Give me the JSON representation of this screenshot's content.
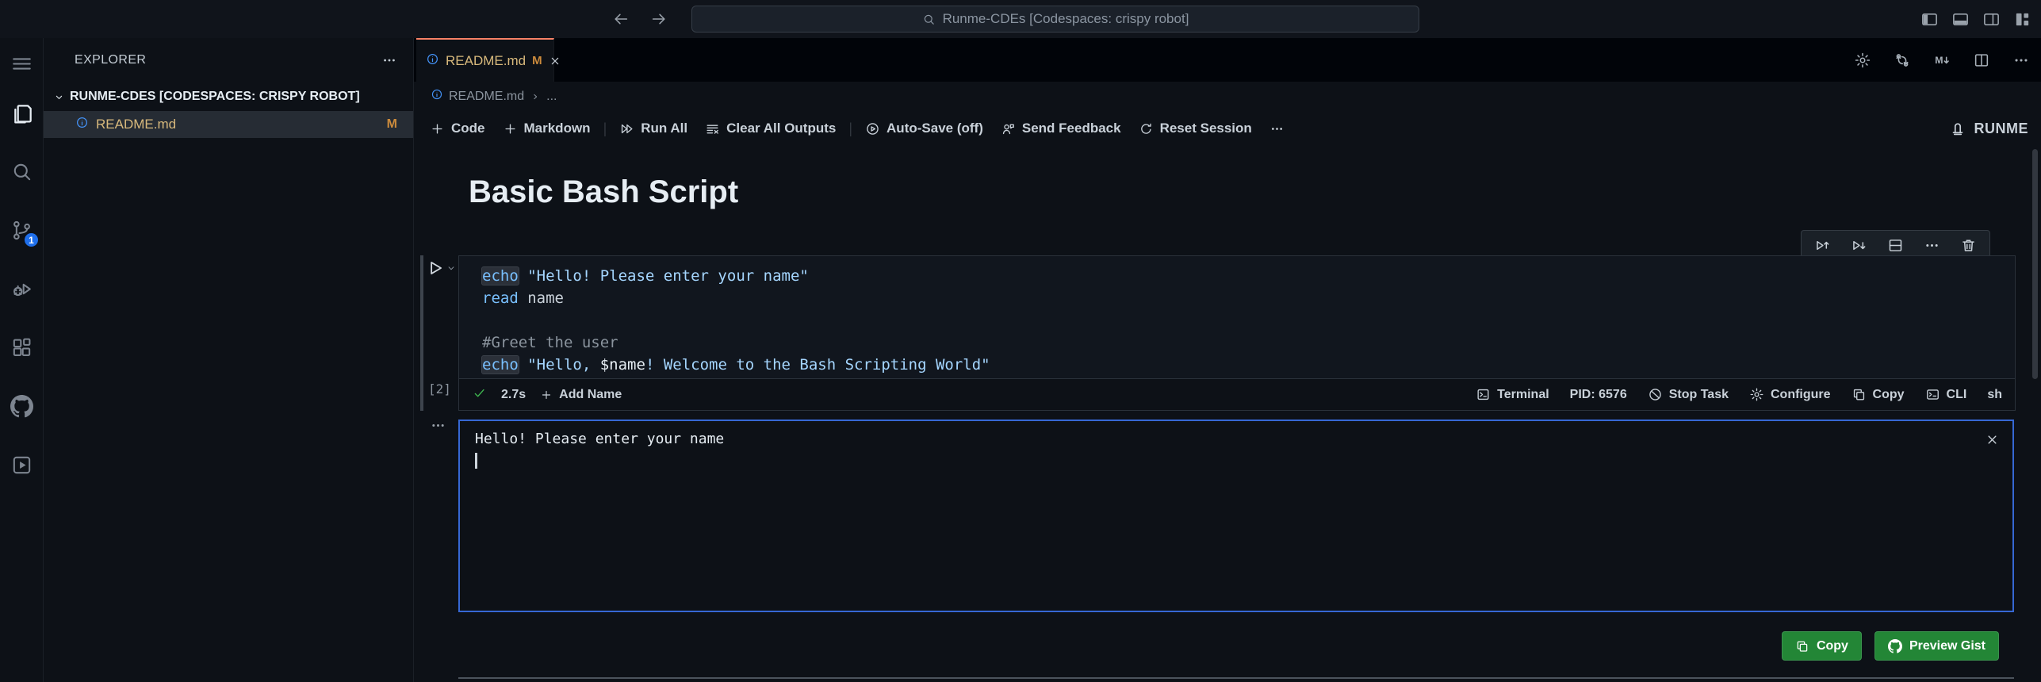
{
  "titlebar": {
    "search_label": "Runme-CDEs [Codespaces: crispy robot]",
    "nav_icons": [
      {
        "name": "arrow-left"
      },
      {
        "name": "arrow-right"
      }
    ],
    "window_icons": [
      {
        "name": "panel-left"
      },
      {
        "name": "panel-bottom"
      },
      {
        "name": "panel-right"
      },
      {
        "name": "layout"
      }
    ]
  },
  "activity_bar": {
    "items": [
      {
        "name": "menu"
      },
      {
        "name": "explorer",
        "active": true
      },
      {
        "name": "search"
      },
      {
        "name": "source-control",
        "badge": "1"
      },
      {
        "name": "run-debug"
      },
      {
        "name": "extensions"
      },
      {
        "name": "github"
      },
      {
        "name": "runme"
      }
    ]
  },
  "sidebar": {
    "title": "EXPLORER",
    "section_label": "RUNME-CDES [CODESPACES: CRISPY ROBOT]",
    "file": {
      "name": "README.md",
      "badge": "M"
    }
  },
  "editor": {
    "tab": {
      "title": "README.md",
      "modified": "M"
    },
    "breadcrumb": {
      "file": "README.md",
      "ellipsis": "..."
    },
    "actions": [
      {
        "name": "gear"
      },
      {
        "name": "session"
      },
      {
        "name": "markdown-run"
      },
      {
        "name": "split-editor"
      },
      {
        "name": "more"
      }
    ]
  },
  "notebook": {
    "toolbar": {
      "items": [
        {
          "icon": "add",
          "label": "Code"
        },
        {
          "icon": "add",
          "label": "Markdown"
        },
        {
          "divider": true
        },
        {
          "icon": "run-all",
          "label": "Run All"
        },
        {
          "icon": "clear-all",
          "label": "Clear All Outputs"
        },
        {
          "divider": true
        },
        {
          "icon": "play-circle",
          "label": "Auto-Save (off)"
        },
        {
          "icon": "feedback",
          "label": "Send Feedback"
        },
        {
          "icon": "refresh",
          "label": "Reset Session"
        },
        {
          "icon": "more",
          "label": ""
        }
      ],
      "brand_label": "RUNME"
    },
    "heading": "Basic Bash Script",
    "cell": {
      "execution_label": "[2]",
      "toolbar_icons": [
        {
          "name": "execute-above"
        },
        {
          "name": "execute-below"
        },
        {
          "name": "split-cell"
        },
        {
          "name": "more"
        },
        {
          "name": "trash"
        }
      ],
      "code_lines": [
        {
          "tokens": [
            {
              "text": "echo",
              "cls": "kw",
              "boxed": true
            },
            {
              "text": " ",
              "cls": "pln"
            },
            {
              "text": "\"Hello! Please enter your name\"",
              "cls": "str"
            }
          ]
        },
        {
          "tokens": [
            {
              "text": "read",
              "cls": "kw"
            },
            {
              "text": " name",
              "cls": "pln"
            }
          ]
        },
        {
          "tokens": []
        },
        {
          "tokens": [
            {
              "text": "#Greet the user",
              "cls": "cmt"
            }
          ]
        },
        {
          "tokens": [
            {
              "text": "echo",
              "cls": "kw",
              "boxed": true
            },
            {
              "text": " ",
              "cls": "pln"
            },
            {
              "text": "\"Hello, ",
              "cls": "str"
            },
            {
              "text": "$name",
              "cls": "var"
            },
            {
              "text": "! Welcome to the Bash Scripting World\"",
              "cls": "str"
            }
          ]
        }
      ],
      "status": {
        "duration": "2.7s",
        "add_name_label": "Add Name"
      },
      "status_right": [
        {
          "icon": "terminal-sq",
          "label": "Terminal"
        },
        {
          "icon": "",
          "label": "PID: 6576"
        },
        {
          "icon": "stop-circle",
          "label": "Stop Task"
        },
        {
          "icon": "gear",
          "label": "Configure"
        },
        {
          "icon": "copy",
          "label": "Copy"
        },
        {
          "icon": "cli",
          "label": "CLI"
        },
        {
          "icon": "",
          "label": "sh"
        }
      ]
    },
    "output": {
      "line1": "Hello! Please enter your name"
    },
    "gist_buttons": [
      {
        "icon": "copy",
        "label": "Copy"
      },
      {
        "icon": "github",
        "label": "Preview Gist"
      }
    ]
  },
  "colors": {
    "active_tab_accent": "#f78166",
    "modified_file": "#d8b97c",
    "modified_badge": "#cc8b3c",
    "scm_badge": "#1f6feb",
    "button_green": "#238636",
    "output_focus_border": "#3668d4",
    "keyword": "#79c0ff",
    "string": "#a5d6ff",
    "comment": "#8b949e",
    "success_check": "#3fb950"
  }
}
